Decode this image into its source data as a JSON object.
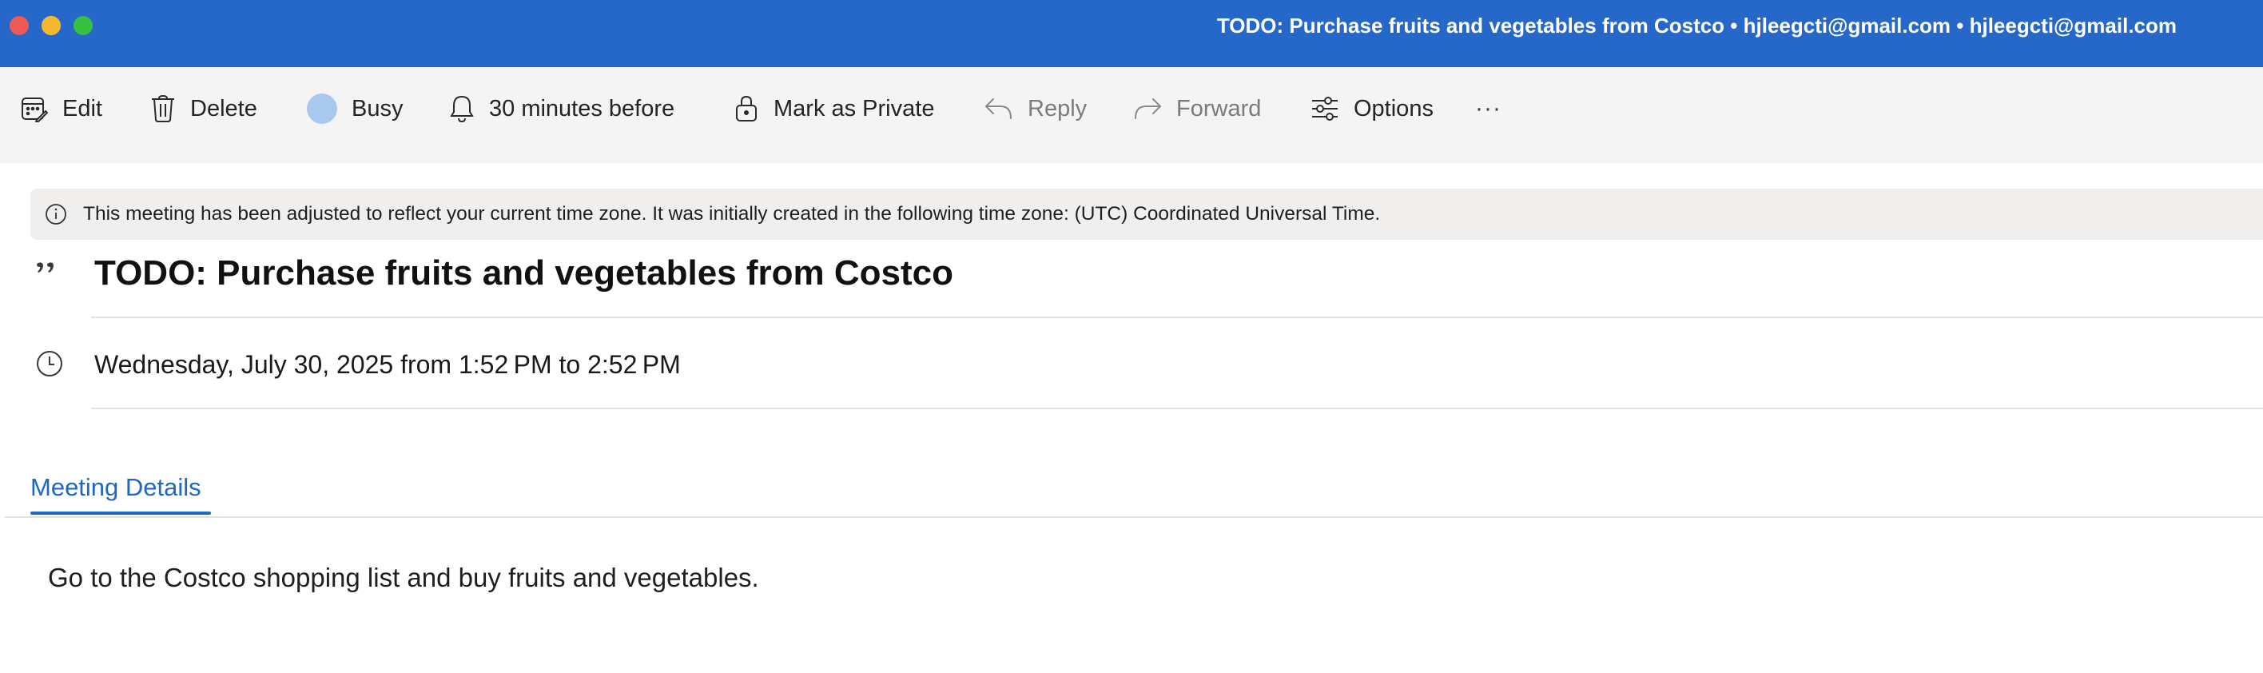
{
  "window": {
    "title": "TODO: Purchase fruits and vegetables from Costco • hjleegcti@gmail.com • hjleegcti@gmail.com"
  },
  "toolbar": {
    "edit_label": "Edit",
    "delete_label": "Delete",
    "busy_label": "Busy",
    "reminder_label": "30 minutes before",
    "private_label": "Mark as Private",
    "reply_label": "Reply",
    "forward_label": "Forward",
    "options_label": "Options",
    "more_label": "···"
  },
  "banner": {
    "text": "This meeting has been adjusted to reflect your current time zone. It was initially created in the following time zone: (UTC) Coordinated Universal Time."
  },
  "event": {
    "subject": "TODO: Purchase fruits and vegetables from Costco",
    "when": "Wednesday, July 30, 2025 from 1:52 PM to 2:52 PM"
  },
  "tabs": {
    "meeting_details_label": "Meeting Details"
  },
  "details": {
    "body": "Go to the Costco shopping list and buy fruits and vegetables."
  },
  "colors": {
    "titlebar": "#2568c9",
    "toolbar": "#f4f4f4",
    "accent": "#1d67c5",
    "busy_status": "#a8c8ee",
    "banner": "#f0efee"
  },
  "icons": {
    "edit": "calendar-edit-icon",
    "delete": "trash-icon",
    "busy": "busy-status-icon",
    "reminder": "bell-icon",
    "private": "lock-icon",
    "reply": "reply-arrow-icon",
    "forward": "forward-arrow-icon",
    "options": "sliders-icon",
    "info": "info-icon",
    "subject": "quote-icon",
    "time": "clock-icon"
  }
}
